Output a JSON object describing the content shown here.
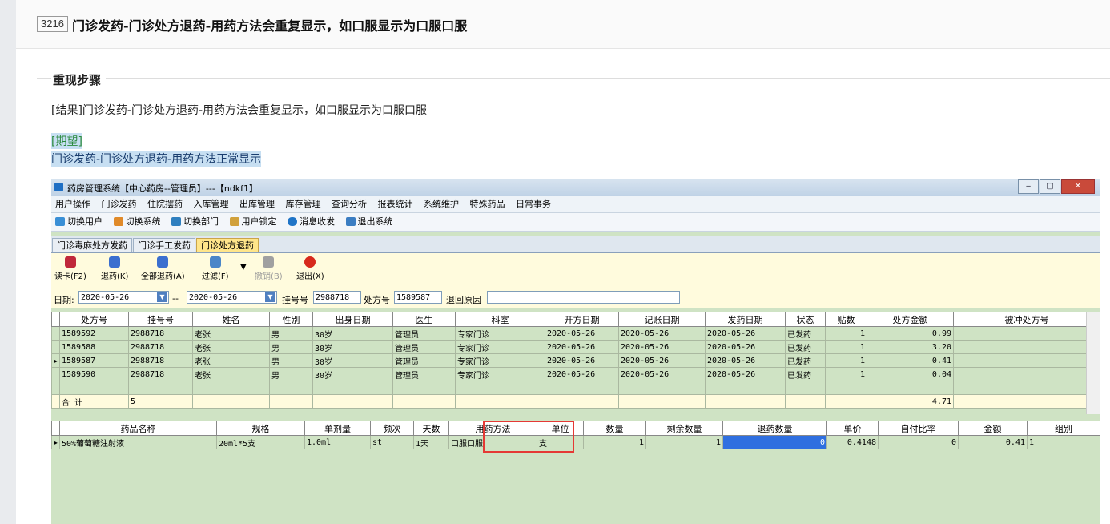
{
  "issue": {
    "id": "3216",
    "title": "门诊发药-门诊处方退药-用药方法会重复显示，如口服显示为口服口服"
  },
  "section": {
    "title": "重现步骤",
    "result_text": "[结果]门诊发药-门诊处方退药-用药方法会重复显示，如口服显示为口服口服",
    "expect_label": "[期望]",
    "expect_text": "门诊发药-门诊处方退药-用药方法正常显示"
  },
  "app": {
    "window_title": "药房管理系统【中心药房--管理员】---【ndkf1】",
    "window_buttons": [
      "‒",
      "▢",
      "✕"
    ],
    "menu": [
      "用户操作",
      "门诊发药",
      "住院摆药",
      "入库管理",
      "出库管理",
      "库存管理",
      "查询分析",
      "报表统计",
      "系统维护",
      "特殊药品",
      "日常事务"
    ],
    "toolbar": [
      {
        "label": "切换用户",
        "color": "#3a8fd6"
      },
      {
        "label": "切换系统",
        "color": "#e08a2a"
      },
      {
        "label": "切换部门",
        "color": "#2f7fbf"
      },
      {
        "label": "用户锁定",
        "color": "#d1a13c"
      },
      {
        "label": "消息收发",
        "color": "#1f74c7"
      },
      {
        "label": "退出系统",
        "color": "#3b7dc2"
      }
    ],
    "tabs": [
      "门诊毒麻处方发药",
      "门诊手工发药",
      "门诊处方退药"
    ],
    "active_tab": "门诊处方退药",
    "action_buttons": [
      {
        "label": "读卡(F2)",
        "color": "#c0283a",
        "disabled": false
      },
      {
        "label": "退药(K)",
        "color": "#3b6fcf",
        "disabled": false
      },
      {
        "label": "全部退药(A)",
        "color": "#3b6fcf",
        "disabled": false
      },
      {
        "label": "过滤(F)",
        "color": "#4a86c8",
        "disabled": false
      },
      {
        "label": "撤销(B)",
        "color": "#a0a0a0",
        "disabled": true
      },
      {
        "label": "退出(X)",
        "color": "#d7291c",
        "disabled": false
      }
    ],
    "filter": {
      "date_label": "日期:",
      "date_from": "2020-05-26",
      "date_sep": "--",
      "date_to": "2020-05-26",
      "reg_label": "挂号号",
      "reg_value": "2988718",
      "rx_label": "处方号",
      "rx_value": "1589587",
      "reason_label": "退回原因",
      "reason_value": ""
    },
    "rx_table": {
      "headers": [
        "处方号",
        "挂号号",
        "姓名",
        "性别",
        "出身日期",
        "医生",
        "科室",
        "开方日期",
        "记账日期",
        "发药日期",
        "状态",
        "贴数",
        "处方金额",
        "被冲处方号"
      ],
      "rows": [
        [
          "1589592",
          "2988718",
          "老张",
          "男",
          "30岁",
          "管理员",
          "专家门诊",
          "2020-05-26",
          "2020-05-26",
          "2020-05-26",
          "已发药",
          "1",
          "0.99",
          ""
        ],
        [
          "1589588",
          "2988718",
          "老张",
          "男",
          "30岁",
          "管理员",
          "专家门诊",
          "2020-05-26",
          "2020-05-26",
          "2020-05-26",
          "已发药",
          "1",
          "3.20",
          ""
        ],
        [
          "1589587",
          "2988718",
          "老张",
          "男",
          "30岁",
          "管理员",
          "专家门诊",
          "2020-05-26",
          "2020-05-26",
          "2020-05-26",
          "已发药",
          "1",
          "0.41",
          ""
        ],
        [
          "1589590",
          "2988718",
          "老张",
          "男",
          "30岁",
          "管理员",
          "专家门诊",
          "2020-05-26",
          "2020-05-26",
          "2020-05-26",
          "已发药",
          "1",
          "0.04",
          ""
        ]
      ],
      "current_row": 2,
      "total_label": "合 计",
      "total_count": "5",
      "total_amount": "4.71"
    },
    "drug_table": {
      "headers": [
        "药品名称",
        "规格",
        "单剂量",
        "频次",
        "天数",
        "用药方法",
        "单位",
        "数量",
        "剩余数量",
        "退药数量",
        "单价",
        "自付比率",
        "金额",
        "组别"
      ],
      "rows": [
        [
          "50%葡萄糖注射液",
          "20ml*5支",
          "1.0ml",
          "st",
          "1天",
          "口服口服",
          "支",
          "1",
          "1",
          "0",
          "0.4148",
          "0",
          "0.41",
          "1"
        ]
      ]
    }
  }
}
